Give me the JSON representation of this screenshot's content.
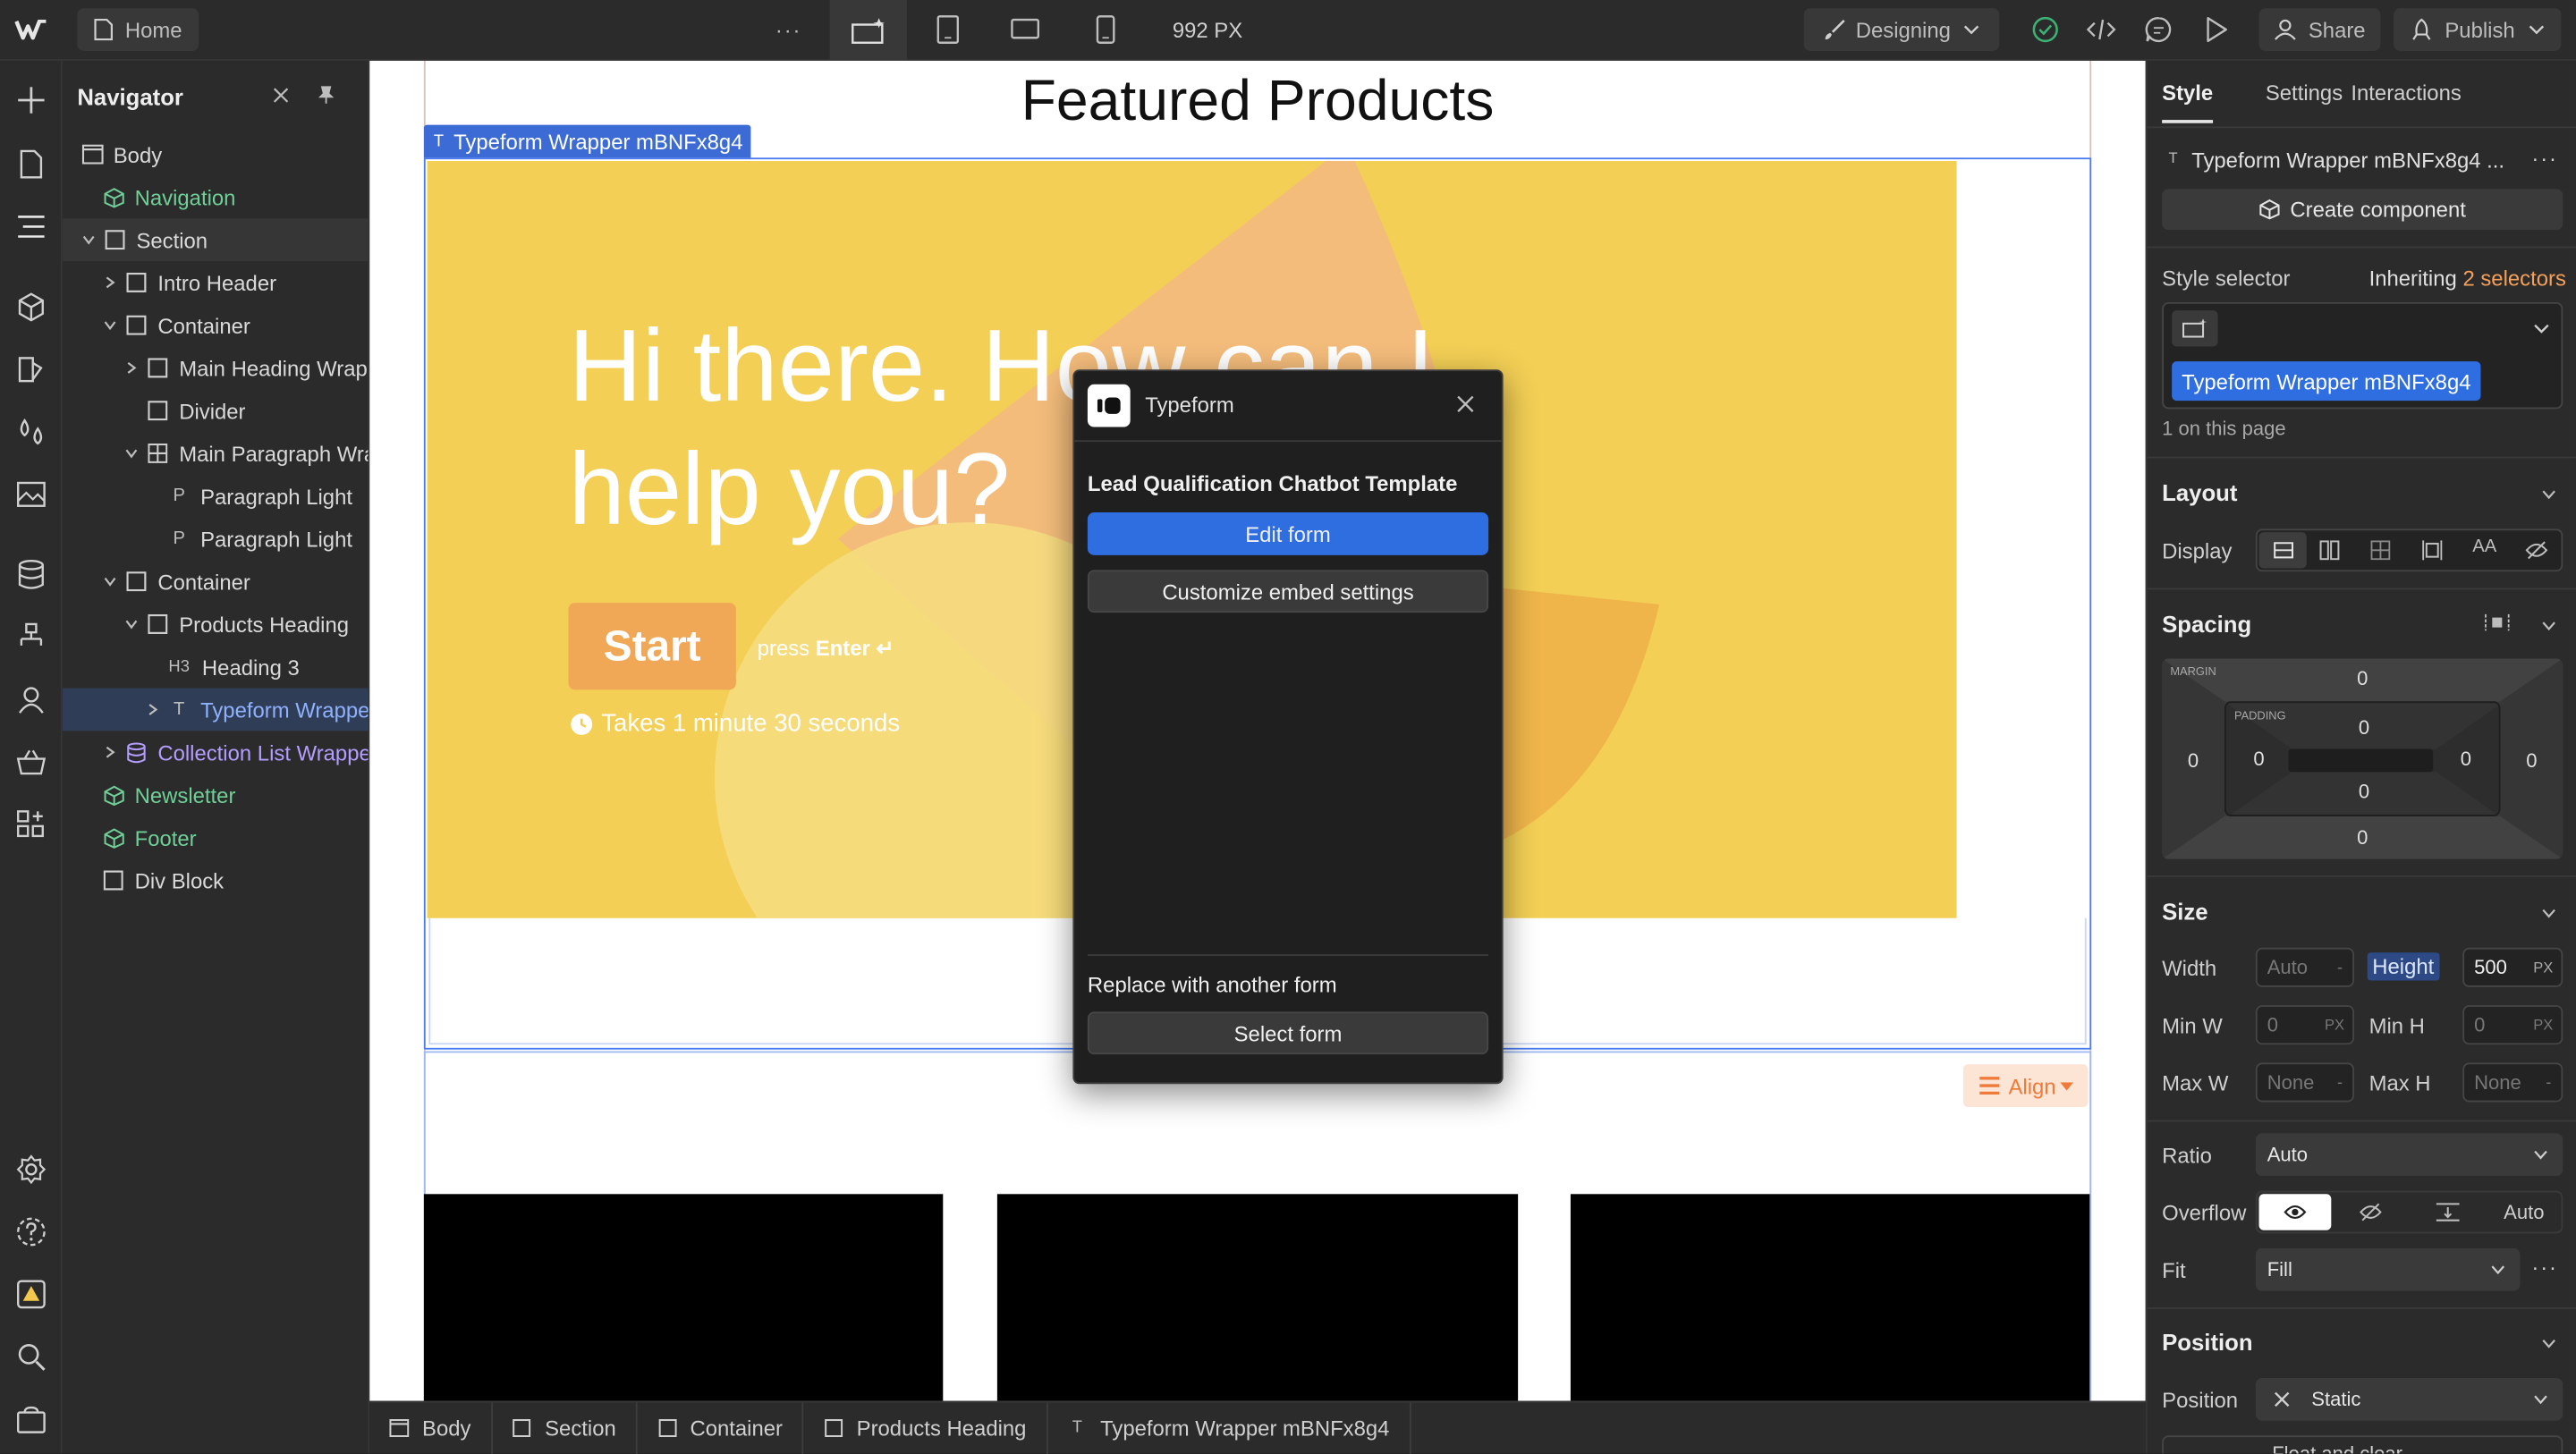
{
  "topbar": {
    "home_label": "Home",
    "more_label": "···",
    "viewport_width": "992 PX",
    "mode_label": "Designing",
    "share_label": "Share",
    "publish_label": "Publish"
  },
  "navigator": {
    "title": "Navigator",
    "items": [
      {
        "label": "Body"
      },
      {
        "label": "Navigation"
      },
      {
        "label": "Section"
      },
      {
        "label": "Intro Header"
      },
      {
        "label": "Container"
      },
      {
        "label": "Main Heading Wrap"
      },
      {
        "label": "Divider"
      },
      {
        "label": "Main Paragraph Wrap"
      },
      {
        "label": "Paragraph Light"
      },
      {
        "label": "Paragraph Light"
      },
      {
        "label": "Container"
      },
      {
        "label": "Products Heading"
      },
      {
        "label": "Heading 3"
      },
      {
        "label": "Typeform Wrapper"
      },
      {
        "label": "Collection List Wrapper"
      },
      {
        "label": "Newsletter"
      },
      {
        "label": "Footer"
      },
      {
        "label": "Div Block"
      }
    ]
  },
  "canvas": {
    "heading": "Featured Products",
    "element_tag": "Typeform Wrapper mBNFx8g4",
    "typeform": {
      "greeting": "Hi there. How can I help you?",
      "start_label": "Start",
      "press_label": "press",
      "enter_label": "Enter ↵",
      "duration_label": "Takes 1 minute 30 seconds"
    },
    "align_label": "Align"
  },
  "modal": {
    "title": "Typeform",
    "template_name": "Lead Qualification Chatbot Template",
    "edit_label": "Edit form",
    "customize_label": "Customize embed settings",
    "replace_label": "Replace with another form",
    "select_label": "Select form"
  },
  "breadcrumb": [
    "Body",
    "Section",
    "Container",
    "Products Heading",
    "Typeform Wrapper mBNFx8g4"
  ],
  "panel": {
    "tabs": [
      "Style",
      "Settings",
      "Interactions"
    ],
    "element_name": "Typeform Wrapper mBNFx8g4 ...",
    "create_component_label": "Create component",
    "style_selector_label": "Style selector",
    "inheriting_label": "Inheriting",
    "inheriting_count": "2 selectors",
    "selector_chip": "Typeform Wrapper mBNFx8g4",
    "on_page_label": "1 on this page",
    "layout": {
      "title": "Layout",
      "display_label": "Display",
      "text_icon": "AA"
    },
    "spacing": {
      "title": "Spacing",
      "margin_label": "MARGIN",
      "padding_label": "PADDING",
      "margin_top": "0",
      "margin_right": "0",
      "margin_bottom": "0",
      "margin_left": "0",
      "padding_top": "0",
      "padding_right": "0",
      "padding_bottom": "0",
      "padding_left": "0"
    },
    "size": {
      "title": "Size",
      "width_label": "Width",
      "width_value": "Auto",
      "width_unit": "-",
      "height_label": "Height",
      "height_value": "500",
      "height_unit": "PX",
      "minw_label": "Min W",
      "minw_value": "0",
      "minw_unit": "PX",
      "minh_label": "Min H",
      "minh_value": "0",
      "minh_unit": "PX",
      "maxw_label": "Max W",
      "maxw_value": "None",
      "maxw_unit": "-",
      "maxh_label": "Max H",
      "maxh_value": "None",
      "maxh_unit": "-",
      "ratio_label": "Ratio",
      "ratio_value": "Auto",
      "overflow_label": "Overflow",
      "overflow_auto": "Auto",
      "fit_label": "Fit",
      "fit_value": "Fill"
    },
    "position": {
      "title": "Position",
      "position_label": "Position",
      "position_value": "Static",
      "next_label": "Float and clear"
    }
  },
  "colors": {
    "accent": "#3d6bd6",
    "typeform_bg": "#f3cf55",
    "start_btn": "#f0a856",
    "selection_blue": "#4a7cf0",
    "align_orange": "#f07a3a"
  }
}
